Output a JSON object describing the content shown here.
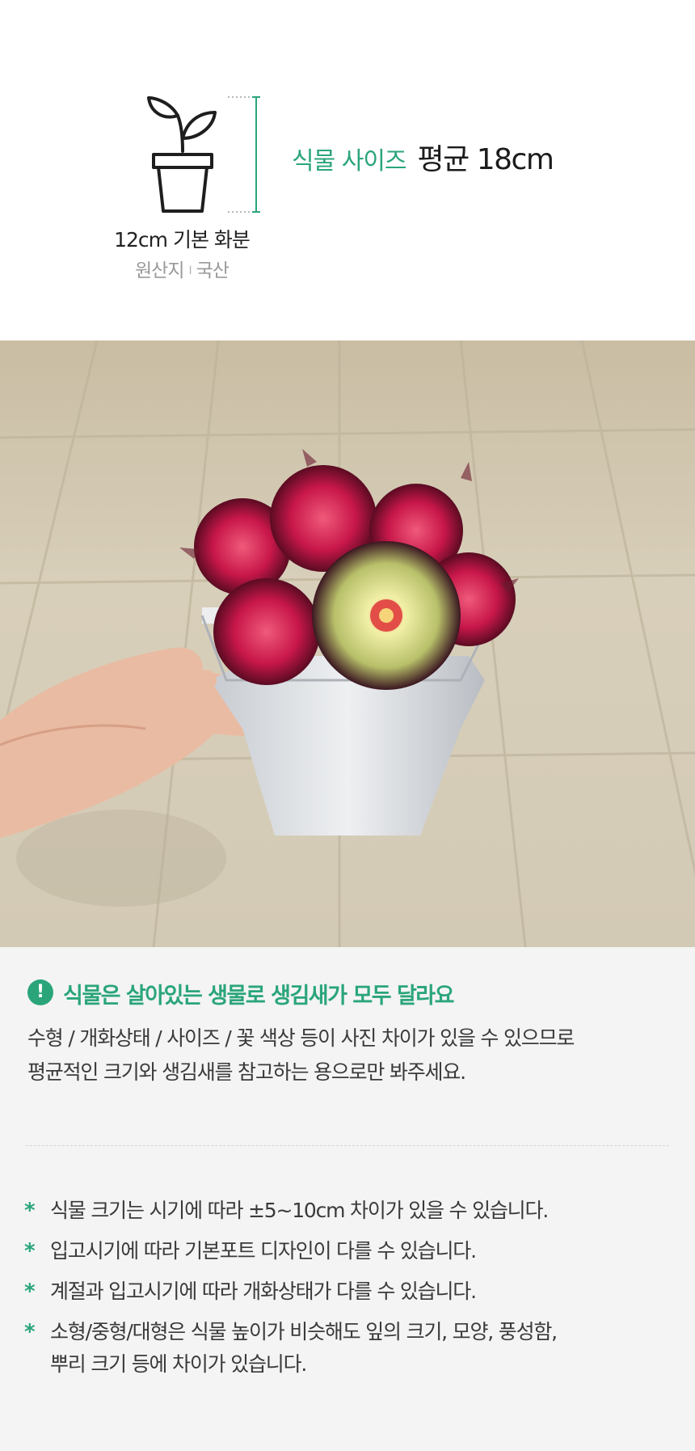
{
  "plant_info": {
    "pot_caption": "12cm 기본 화분",
    "origin_label": "원산지",
    "origin_separator": "I",
    "origin_value": "국산",
    "size_label": "식물 사이즈",
    "size_value": "평균 18cm",
    "accent_color": "#2aa57a"
  },
  "photo": {
    "subject": "red and green rosette succulent in white hexagonal pot held in hand",
    "icon": "pot-plant-icon"
  },
  "notice": {
    "icon": "exclamation-icon",
    "title": "식물은 살아있는 생물로 생김새가 모두 달라요",
    "body_line1": "수형 / 개화상태 / 사이즈 / 꽃 색상 등이 사진 차이가 있을 수 있으므로",
    "body_line2": "평균적인 크기와 생김새를 참고하는 용으로만 봐주세요.",
    "bullet_symbol": "*",
    "items": [
      "식물 크기는 시기에 따라 ±5~10cm 차이가 있을 수 있습니다.",
      "입고시기에 따라 기본포트 디자인이 다를 수 있습니다.",
      "계절과 입고시기에 따라 개화상태가 다를 수 있습니다.",
      "소형/중형/대형은 식물 높이가 비슷해도 잎의 크기, 모양,  풍성함,",
      "뿌리 크기 등에 차이가 있습니다."
    ]
  }
}
